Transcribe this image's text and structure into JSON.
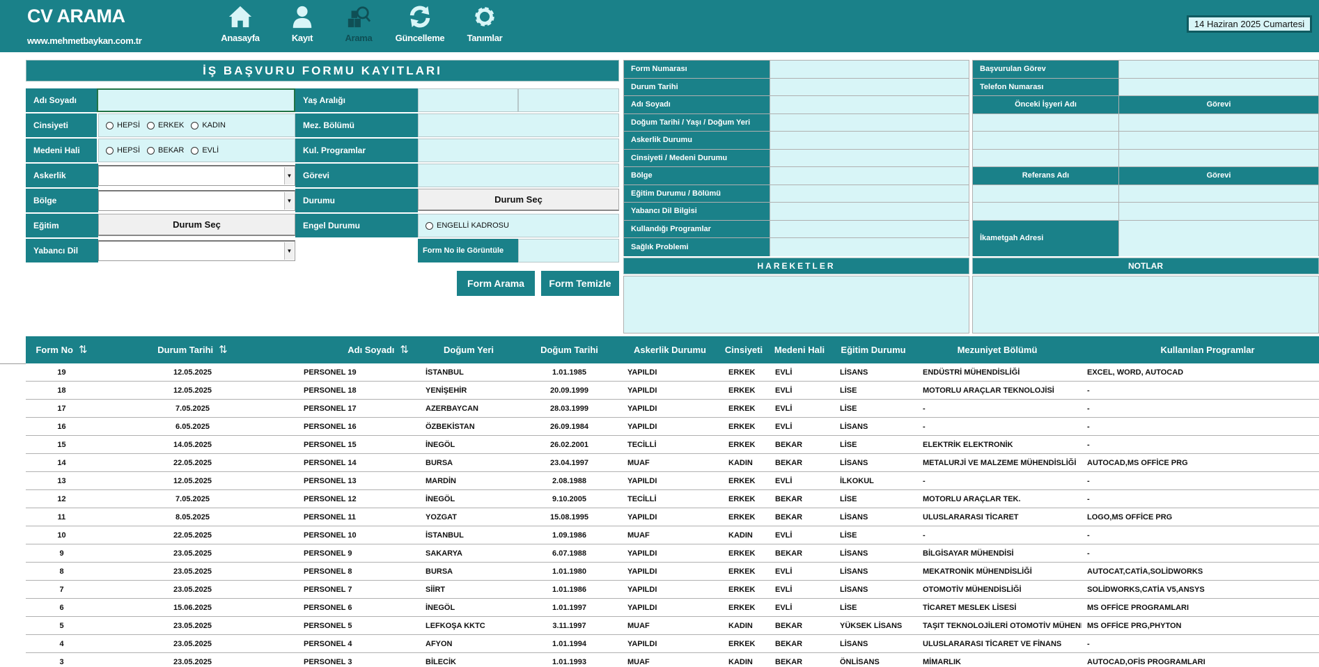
{
  "header": {
    "title": "CV ARAMA",
    "url": "www.mehmetbaykan.com.tr",
    "date": "14 Haziran 2025 Cumartesi",
    "nav": [
      {
        "label": "Anasayfa",
        "icon": "home-icon"
      },
      {
        "label": "Kayıt",
        "icon": "user-icon"
      },
      {
        "label": "Arama",
        "icon": "search-records-icon",
        "active": true
      },
      {
        "label": "Güncelleme",
        "icon": "refresh-icon"
      },
      {
        "label": "Tanımlar",
        "icon": "gear-icon"
      }
    ]
  },
  "form": {
    "title": "İŞ BAŞVURU FORMU KAYITLARI",
    "labels": {
      "name": "Adı Soyadı",
      "gender": "Cinsiyeti",
      "marital": "Medeni Hali",
      "military": "Askerlik",
      "region": "Bölge",
      "education": "Eğitim",
      "language": "Yabancı Dil",
      "age": "Yaş Aralığı",
      "dept": "Mez. Bölümü",
      "programs": "Kul. Programlar",
      "position": "Görevi",
      "status": "Durumu",
      "disability": "Engel Durumu",
      "formno": "Form No ile Görüntüle"
    },
    "gender_options": [
      "HEPSİ",
      "ERKEK",
      "KADIN"
    ],
    "marital_options": [
      "HEPSİ",
      "BEKAR",
      "EVLİ"
    ],
    "disability_option": "ENGELLİ KADROSU",
    "select_button": "Durum Seç",
    "search_button": "Form Arama",
    "clear_button": "Form Temizle"
  },
  "detail": {
    "left_labels": [
      "Form Numarası",
      "Durum Tarihi",
      "Adı Soyadı",
      "Doğum Tarihi / Yaşı / Doğum Yeri",
      "Askerlik Durumu",
      "Cinsiyeti / Medeni Durumu",
      "Bölge",
      "Eğitim Durumu / Bölümü",
      "Yabancı Dil Bilgisi",
      "Kullandığı Programlar",
      "Sağlık Problemi"
    ],
    "applied_position": "Başvurulan Görev",
    "phone": "Telefon Numarası",
    "prev_employer": "Önceki İşyeri Adı",
    "role": "Görevi",
    "reference": "Referans Adı",
    "address": "İkametgah Adresi",
    "movements": "HAREKETLER",
    "notes": "NOTLAR"
  },
  "table": {
    "columns": [
      "Form No",
      "Durum Tarihi",
      "Adı Soyadı",
      "Doğum Yeri",
      "Doğum Tarihi",
      "Askerlik Durumu",
      "Cinsiyeti",
      "Medeni Hali",
      "Eğitim Durumu",
      "Mezuniyet Bölümü",
      "Kullanılan Programlar"
    ],
    "sort_icon": "⇅",
    "rows": [
      [
        "19",
        "12.05.2025",
        "PERSONEL 19",
        "İSTANBUL",
        "1.01.1985",
        "YAPILDI",
        "ERKEK",
        "EVLİ",
        "LİSANS",
        "ENDÜSTRİ MÜHENDİSLİĞİ",
        "EXCEL, WORD, AUTOCAD"
      ],
      [
        "18",
        "12.05.2025",
        "PERSONEL 18",
        "YENİŞEHİR",
        "20.09.1999",
        "YAPILDI",
        "ERKEK",
        "EVLİ",
        "LİSE",
        "MOTORLU ARAÇLAR TEKNOLOJİSİ",
        "-"
      ],
      [
        "17",
        "7.05.2025",
        "PERSONEL 17",
        "AZERBAYCAN",
        "28.03.1999",
        "YAPILDI",
        "ERKEK",
        "EVLİ",
        "LİSE",
        "-",
        "-"
      ],
      [
        "16",
        "6.05.2025",
        "PERSONEL 16",
        "ÖZBEKİSTAN",
        "26.09.1984",
        "YAPILDI",
        "ERKEK",
        "EVLİ",
        "LİSANS",
        "-",
        "-"
      ],
      [
        "15",
        "14.05.2025",
        "PERSONEL 15",
        "İNEGÖL",
        "26.02.2001",
        "TECİLLİ",
        "ERKEK",
        "BEKAR",
        "LİSE",
        "ELEKTRİK ELEKTRONİK",
        "-"
      ],
      [
        "14",
        "22.05.2025",
        "PERSONEL 14",
        "BURSA",
        "23.04.1997",
        "MUAF",
        "KADIN",
        "BEKAR",
        "LİSANS",
        "METALURJİ VE MALZEME MÜHENDİSLİĞİ",
        "AUTOCAD,MS OFFİCE PRG"
      ],
      [
        "13",
        "12.05.2025",
        "PERSONEL 13",
        "MARDİN",
        "2.08.1988",
        "YAPILDI",
        "ERKEK",
        "EVLİ",
        "İLKOKUL",
        "-",
        "-"
      ],
      [
        "12",
        "7.05.2025",
        "PERSONEL 12",
        "İNEGÖL",
        "9.10.2005",
        "TECİLLİ",
        "ERKEK",
        "BEKAR",
        "LİSE",
        "MOTORLU ARAÇLAR TEK.",
        "-"
      ],
      [
        "11",
        "8.05.2025",
        "PERSONEL 11",
        "YOZGAT",
        "15.08.1995",
        "YAPILDI",
        "ERKEK",
        "BEKAR",
        "LİSANS",
        "ULUSLARARASI TİCARET",
        "LOGO,MS OFFİCE PRG"
      ],
      [
        "10",
        "22.05.2025",
        "PERSONEL 10",
        "İSTANBUL",
        "1.09.1986",
        "MUAF",
        "KADIN",
        "EVLİ",
        "LİSE",
        "-",
        "-"
      ],
      [
        "9",
        "23.05.2025",
        "PERSONEL 9",
        "SAKARYA",
        "6.07.1988",
        "YAPILDI",
        "ERKEK",
        "BEKAR",
        "LİSANS",
        "BİLGİSAYAR MÜHENDİSİ",
        "-"
      ],
      [
        "8",
        "23.05.2025",
        "PERSONEL 8",
        "BURSA",
        "1.01.1980",
        "YAPILDI",
        "ERKEK",
        "EVLİ",
        "LİSANS",
        "MEKATRONİK MÜHENDİSLİĞİ",
        "AUTOCAT,CATİA,SOLİDWORKS"
      ],
      [
        "7",
        "23.05.2025",
        "PERSONEL 7",
        "SİİRT",
        "1.01.1986",
        "YAPILDI",
        "ERKEK",
        "EVLİ",
        "LİSANS",
        "OTOMOTİV MÜHENDİSLİĞİ",
        "SOLİDWORKS,CATİA V5,ANSYS"
      ],
      [
        "6",
        "15.06.2025",
        "PERSONEL 6",
        "İNEGÖL",
        "1.01.1997",
        "YAPILDI",
        "ERKEK",
        "EVLİ",
        "LİSE",
        "TİCARET MESLEK LİSESİ",
        "MS OFFİCE PROGRAMLARI"
      ],
      [
        "5",
        "23.05.2025",
        "PERSONEL 5",
        "LEFKOŞA KKTC",
        "3.11.1997",
        "MUAF",
        "KADIN",
        "BEKAR",
        "YÜKSEK LİSANS",
        "TAŞIT TEKNOLOJİLERİ OTOMOTİV MÜHENDİSLİĞİ",
        "MS OFFİCE PRG,PHYTON"
      ],
      [
        "4",
        "23.05.2025",
        "PERSONEL 4",
        "AFYON",
        "1.01.1994",
        "YAPILDI",
        "ERKEK",
        "BEKAR",
        "LİSANS",
        "ULUSLARARASI TİCARET VE FİNANS",
        "-"
      ],
      [
        "3",
        "23.05.2025",
        "PERSONEL 3",
        "BİLECİK",
        "1.01.1993",
        "MUAF",
        "KADIN",
        "BEKAR",
        "ÖNLİSANS",
        "MİMARLIK",
        "AUTOCAD,OFİS PROGRAMLARI"
      ]
    ]
  },
  "colors": {
    "primary": "#1a8189",
    "field": "#d8f5f7",
    "active_nav": "#0f4f55"
  }
}
